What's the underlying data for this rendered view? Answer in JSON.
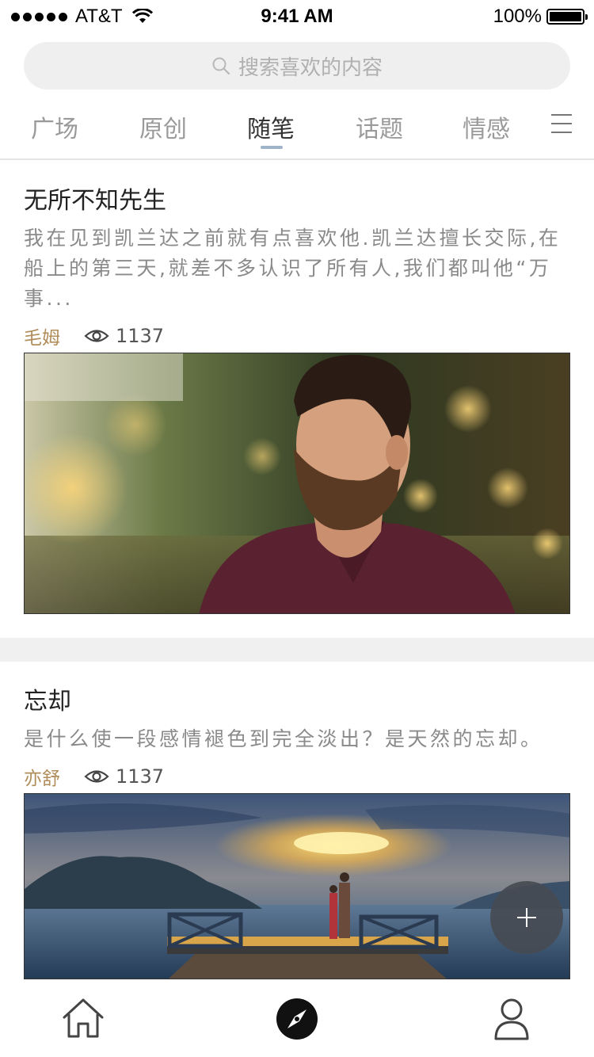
{
  "status_bar": {
    "carrier": "AT&T",
    "time": "9:41 AM",
    "battery": "100%"
  },
  "search": {
    "placeholder": "搜索喜欢的内容"
  },
  "tabs": [
    {
      "label": "广场"
    },
    {
      "label": "原创"
    },
    {
      "label": "随笔",
      "active": true
    },
    {
      "label": "话题"
    },
    {
      "label": "情感"
    }
  ],
  "articles": [
    {
      "title": "无所不知先生",
      "excerpt": "我在见到凯兰达之前就有点喜欢他.凯兰达擅长交际,在船上的第三天,就差不多认识了所有人,我们都叫他“万事...",
      "author": "毛姆",
      "views": "1137"
    },
    {
      "title": "忘却",
      "excerpt": "是什么使一段感情褪色到完全淡出？是天然的忘却。",
      "author": "亦舒",
      "views": "1137"
    }
  ],
  "colors": {
    "accent_author": "#b08d5a",
    "tab_indicator": "#9fb4c8",
    "fab": "#464b52"
  },
  "icons": {
    "search": "search-icon",
    "menu": "menu-icon",
    "views": "eye-icon",
    "add": "plus-icon",
    "home": "home-icon",
    "discover": "compass-icon",
    "profile": "user-icon"
  }
}
